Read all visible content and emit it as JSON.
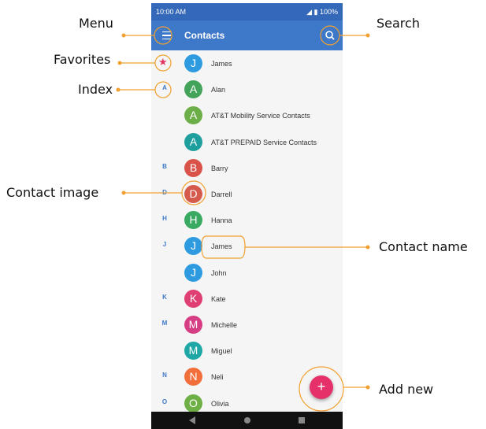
{
  "status": {
    "time": "10:00 AM",
    "battery": "100%"
  },
  "toolbar": {
    "title": "Contacts"
  },
  "favorites_icon": "star-icon",
  "contacts": [
    {
      "index": "",
      "initial": "J",
      "name": "James",
      "color": "#2e9be0",
      "favorite": true
    },
    {
      "index": "A",
      "initial": "A",
      "name": "Alan",
      "color": "#43a35a"
    },
    {
      "index": "",
      "initial": "A",
      "name": "AT&T Mobility Service Contacts",
      "color": "#6cae48"
    },
    {
      "index": "",
      "initial": "A",
      "name": "AT&T PREPAID Service Contacts",
      "color": "#1f9e9e"
    },
    {
      "index": "B",
      "initial": "B",
      "name": "Barry",
      "color": "#d9534a"
    },
    {
      "index": "D",
      "initial": "D",
      "name": "Darrell",
      "color": "#d65a4c"
    },
    {
      "index": "H",
      "initial": "H",
      "name": "Hanna",
      "color": "#3aaa62"
    },
    {
      "index": "J",
      "initial": "J",
      "name": "James",
      "color": "#2e9be0"
    },
    {
      "index": "",
      "initial": "J",
      "name": "John",
      "color": "#2e9be0"
    },
    {
      "index": "K",
      "initial": "K",
      "name": "Kate",
      "color": "#df3f72"
    },
    {
      "index": "M",
      "initial": "M",
      "name": "Michelle",
      "color": "#d63e84"
    },
    {
      "index": "",
      "initial": "M",
      "name": "Miguel",
      "color": "#1fa7a5"
    },
    {
      "index": "N",
      "initial": "N",
      "name": "Neli",
      "color": "#f26f3c"
    },
    {
      "index": "O",
      "initial": "O",
      "name": "Olivia",
      "color": "#6fb046"
    }
  ],
  "fab": {
    "label": "+"
  },
  "annotations": {
    "menu": "Menu",
    "search": "Search",
    "favorites": "Favorites",
    "index": "Index",
    "contact_image": "Contact image",
    "contact_name": "Contact name",
    "add_new": "Add new"
  },
  "colors": {
    "toolbar": "#3e78c8",
    "accent": "#e5306a",
    "callout": "#f0a030"
  }
}
